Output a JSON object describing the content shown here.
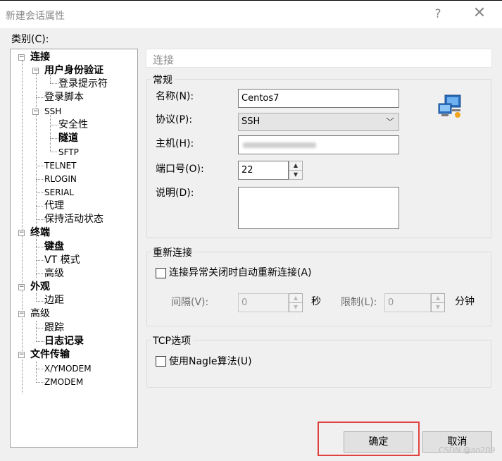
{
  "window": {
    "title": "新建会话属性",
    "help_glyph": "?",
    "close_glyph": "✕"
  },
  "category_label": "类别(C):",
  "tree": {
    "connection": "连接",
    "auth": "用户身份验证",
    "login_prompts": "登录提示符",
    "login_scripts": "登录脚本",
    "ssh": "SSH",
    "security": "安全性",
    "tunnel": "隧道",
    "sftp": "SFTP",
    "telnet": "TELNET",
    "rlogin": "RLOGIN",
    "serial": "SERIAL",
    "proxy": "代理",
    "keepalive": "保持活动状态",
    "terminal": "终端",
    "keyboard": "键盘",
    "vt_mode": "VT 模式",
    "terminal_advanced": "高级",
    "appearance": "外观",
    "margins": "边距",
    "advanced": "高级",
    "trace": "跟踪",
    "logging": "日志记录",
    "file_transfer": "文件传输",
    "xymodem": "X/YMODEM",
    "zmodem": "ZMODEM"
  },
  "panel": {
    "header": "连接",
    "general": {
      "title": "常规",
      "name_label": "名称(N):",
      "name_value": "Centos7",
      "protocol_label": "协议(P):",
      "protocol_value": "SSH",
      "host_label": "主机(H):",
      "port_label": "端口号(O):",
      "port_value": "22",
      "desc_label": "说明(D):"
    },
    "reconnect": {
      "title": "重新连接",
      "auto_reconnect": "连接异常关闭时自动重新连接(A)",
      "interval_label": "间隔(V):",
      "interval_value": "0",
      "seconds": "秒",
      "limit_label": "限制(L):",
      "limit_value": "0",
      "minutes": "分钟"
    },
    "tcp": {
      "title": "TCP选项",
      "nagle": "使用Nagle算法(U)"
    }
  },
  "buttons": {
    "ok": "确定",
    "cancel": "取消"
  },
  "watermark": "CSDN @ao209",
  "colors": {
    "highlight": "#e0413e"
  }
}
